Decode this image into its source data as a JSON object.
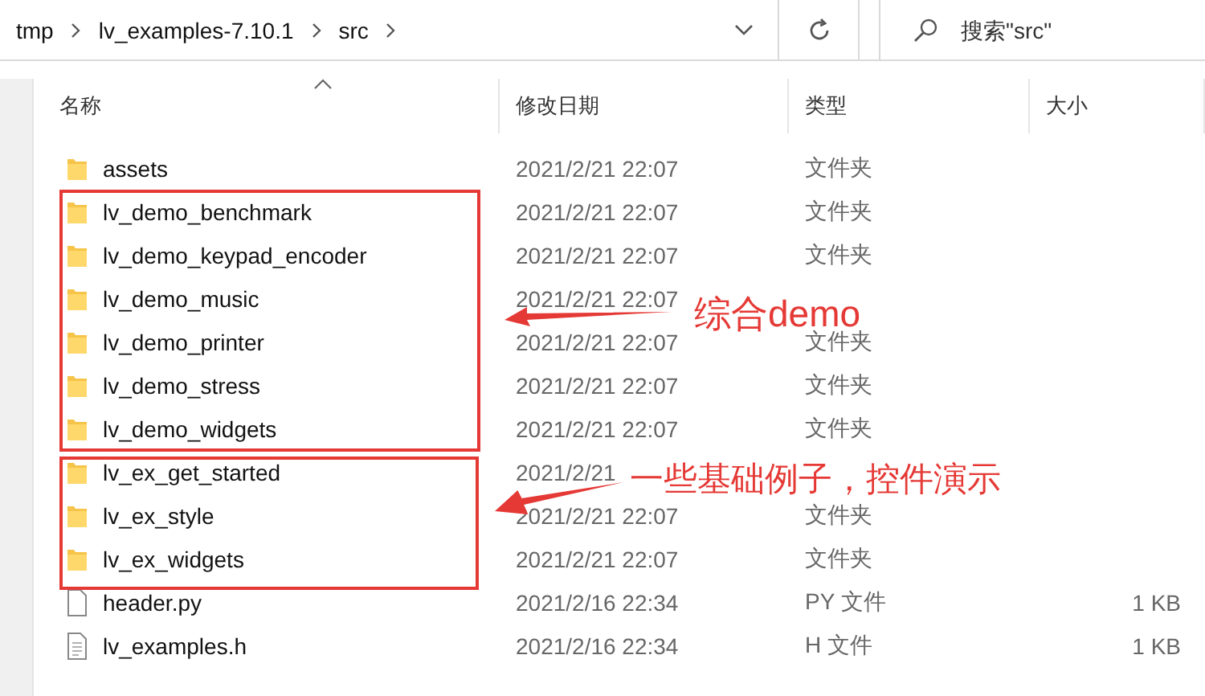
{
  "address_bar": {
    "breadcrumbs": [
      "tmp",
      "lv_examples-7.10.1",
      "src"
    ]
  },
  "search": {
    "placeholder": "搜索\"src\""
  },
  "columns": [
    "名称",
    "修改日期",
    "类型",
    "大小"
  ],
  "rows": [
    {
      "kind": "folder",
      "name": "assets",
      "date": "2021/2/21 22:07",
      "type": "文件夹"
    },
    {
      "kind": "folder",
      "name": "lv_demo_benchmark",
      "date": "2021/2/21 22:07",
      "type": "文件夹"
    },
    {
      "kind": "folder",
      "name": "lv_demo_keypad_encoder",
      "date": "2021/2/21 22:07",
      "type": "文件夹"
    },
    {
      "kind": "folder",
      "name": "lv_demo_music",
      "date": "2021/2/21 22:07"
    },
    {
      "kind": "folder",
      "name": "lv_demo_printer",
      "date": "2021/2/21 22:07",
      "type": "文件夹"
    },
    {
      "kind": "folder",
      "name": "lv_demo_stress",
      "date": "2021/2/21 22:07",
      "type": "文件夹"
    },
    {
      "kind": "folder",
      "name": "lv_demo_widgets",
      "date": "2021/2/21 22:07",
      "type": "文件夹"
    },
    {
      "kind": "folder",
      "name": "lv_ex_get_started",
      "date": "2021/2/21"
    },
    {
      "kind": "folder",
      "name": "lv_ex_style",
      "date": "2021/2/21 22:07",
      "type": "文件夹"
    },
    {
      "kind": "folder",
      "name": "lv_ex_widgets",
      "date": "2021/2/21 22:07",
      "type": "文件夹"
    },
    {
      "kind": "file",
      "name": "header.py",
      "date": "2021/2/16 22:34",
      "type": "PY 文件",
      "size": "1 KB"
    },
    {
      "kind": "text-file",
      "name": "lv_examples.h",
      "date": "2021/2/16 22:34",
      "type": "H 文件",
      "size": "1 KB"
    }
  ],
  "annotations": [
    {
      "text": "综合demo"
    },
    {
      "text": "一些基础例子，控件演示"
    }
  ]
}
